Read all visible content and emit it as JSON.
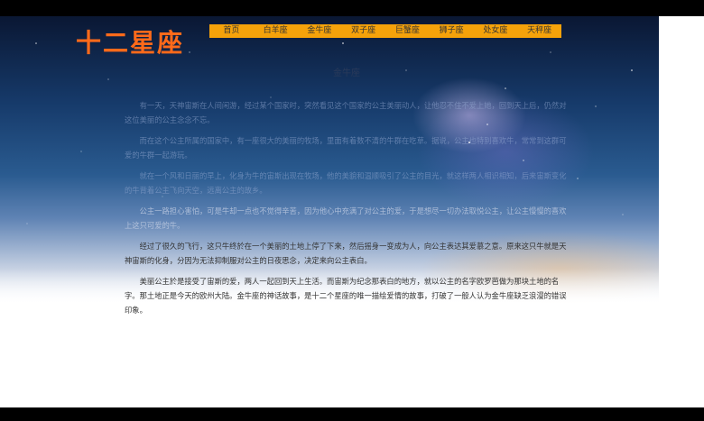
{
  "site": {
    "logo": "十二星座"
  },
  "nav": {
    "items": [
      {
        "label": "首页"
      },
      {
        "label": "白羊座"
      },
      {
        "label": "金牛座"
      },
      {
        "label": "双子座"
      },
      {
        "label": "巨蟹座"
      },
      {
        "label": "狮子座"
      },
      {
        "label": "处女座"
      },
      {
        "label": "天秤座"
      }
    ]
  },
  "article": {
    "title": "金牛座",
    "paragraphs": [
      "有一天，天神宙斯在人间闲游，经过某个国家时，突然看见这个国家的公主美丽动人，让他忍不住不爱上她，回到天上后，仍然对这位美丽的公主念念不忘。",
      "而在这个公主所属的国家中，有一座很大的美丽的牧场，里面有着数不清的牛群在吃草。据说，公主也特别喜欢牛，常常到这群可爱的牛群一起游玩。",
      "就在一个风和日丽的早上，化身为牛的宙斯出现在牧场，他的美貌和温顺吸引了公主的目光，就这样两人相识相知，后来宙斯变化的牛背着公主飞向天空，远离公主的故乡。",
      "公主一路担心害怕，可是牛却一点也不觉得辛苦，因为他心中充满了对公主的爱，于是想尽一切办法取悦公主，让公主慢慢的喜欢上这只可爱的牛。",
      "经过了很久的飞行，这只牛终於在一个美丽的土地上停了下来，然后摇身一变成为人，向公主表达其爱慕之意。原来这只牛就是天神宙斯的化身，分因为无法抑制服对公主的日夜思念，决定来向公主表白。",
      "美丽公主於是接受了宙斯的爱，两人一起回到天上生活。而宙斯为纪念那表白的地方，就以公主的名字欧罗芭做为那块土地的名字。那土地正是今天的欧州大陆。金牛座的神话故事，是十二个星座的唯一描绘爱情的故事，打破了一般人认为金牛座缺乏浪漫的错误印象。"
    ]
  },
  "colors": {
    "logo": "#ff6a1a",
    "nav_background": "#f5a20a",
    "body_text": "#333333"
  }
}
